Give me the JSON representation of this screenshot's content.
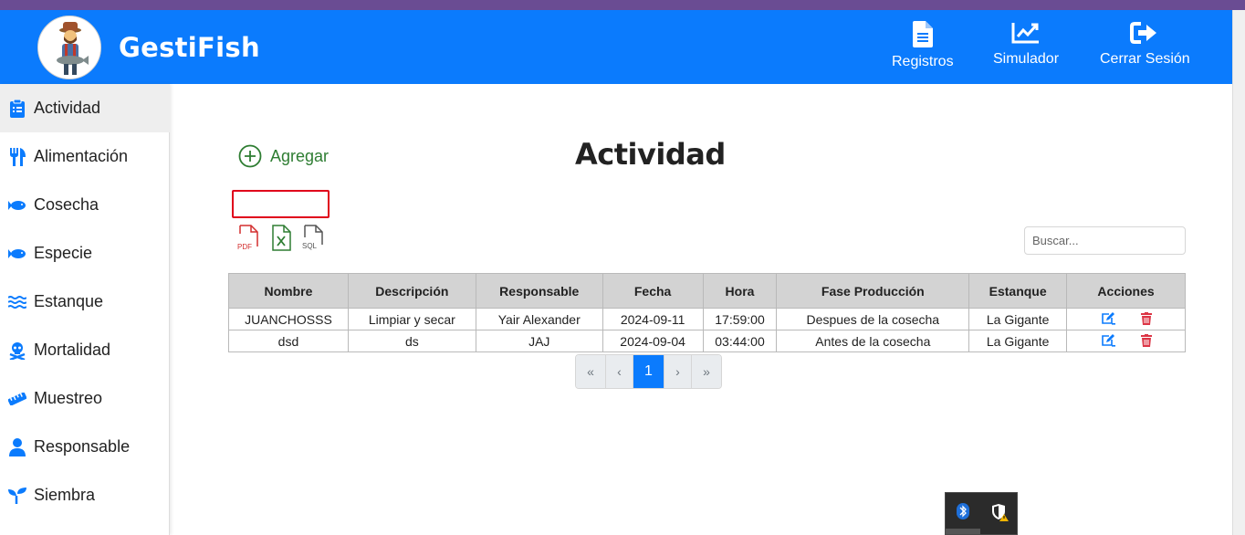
{
  "brand": "GestiFish",
  "nav": {
    "registros": "Registros",
    "simulador": "Simulador",
    "cerrar": "Cerrar Sesión"
  },
  "sidebar": {
    "items": [
      {
        "label": "Actividad",
        "icon": "clipboard-icon"
      },
      {
        "label": "Alimentación",
        "icon": "utensils-icon"
      },
      {
        "label": "Cosecha",
        "icon": "fish-icon"
      },
      {
        "label": "Especie",
        "icon": "fish-icon"
      },
      {
        "label": "Estanque",
        "icon": "water-icon"
      },
      {
        "label": "Mortalidad",
        "icon": "skull-crossbones-icon"
      },
      {
        "label": "Muestreo",
        "icon": "ruler-icon"
      },
      {
        "label": "Responsable",
        "icon": "user-icon"
      },
      {
        "label": "Siembra",
        "icon": "seedling-icon"
      }
    ],
    "active": "Actividad"
  },
  "main": {
    "title": "Actividad",
    "add_label": "Agregar",
    "search_placeholder": "Buscar...",
    "exports": [
      "PDF",
      "SQL"
    ]
  },
  "table": {
    "headers": [
      "Nombre",
      "Descripción",
      "Responsable",
      "Fecha",
      "Hora",
      "Fase Producción",
      "Estanque",
      "Acciones"
    ],
    "rows": [
      [
        "JUANCHOSSS",
        "Limpiar y secar",
        "Yair Alexander",
        "2024-09-11",
        "17:59:00",
        "Despues de la cosecha",
        "La Gigante"
      ],
      [
        "dsd",
        "ds",
        "JAJ",
        "2024-09-04",
        "03:44:00",
        "Antes de la cosecha",
        "La Gigante"
      ]
    ]
  },
  "pagination": {
    "first": "«",
    "prev": "‹",
    "current": "1",
    "next": "›",
    "last": "»"
  },
  "colors": {
    "primary": "#0b7bfd",
    "add_green": "#2e7d32",
    "delete_red": "#dc3545",
    "highlight_box": "#e0001b"
  }
}
